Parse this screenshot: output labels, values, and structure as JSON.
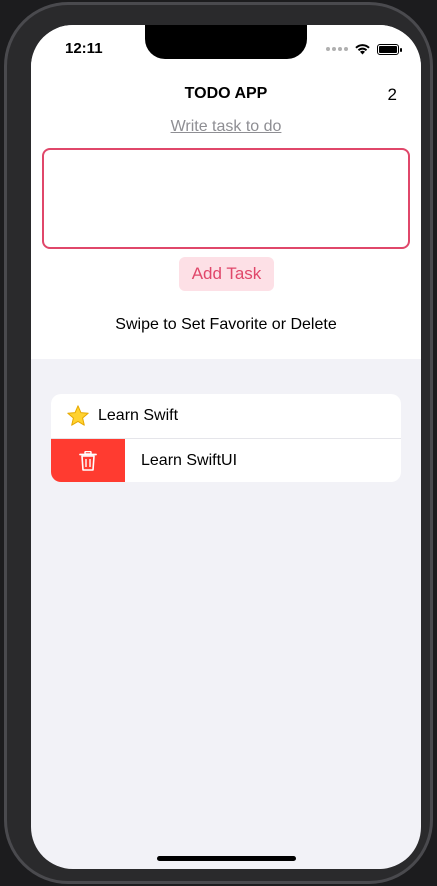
{
  "status_bar": {
    "time": "12:11"
  },
  "header": {
    "title": "TODO APP",
    "task_count": "2"
  },
  "input": {
    "label": "Write task to do",
    "value": ""
  },
  "add_button": {
    "label": "Add Task"
  },
  "hint": "Swipe to Set Favorite or Delete",
  "tasks": [
    {
      "label": "Learn Swift",
      "favorite": true,
      "icon": "star-icon"
    },
    {
      "label": "Learn SwiftUI",
      "favorite": false,
      "swipe_action": "delete",
      "icon": "trash-icon"
    }
  ],
  "colors": {
    "accent": "#e0476a",
    "button_bg": "#fde0e6",
    "delete": "#ff3b30",
    "list_bg": "#f2f2f7"
  }
}
